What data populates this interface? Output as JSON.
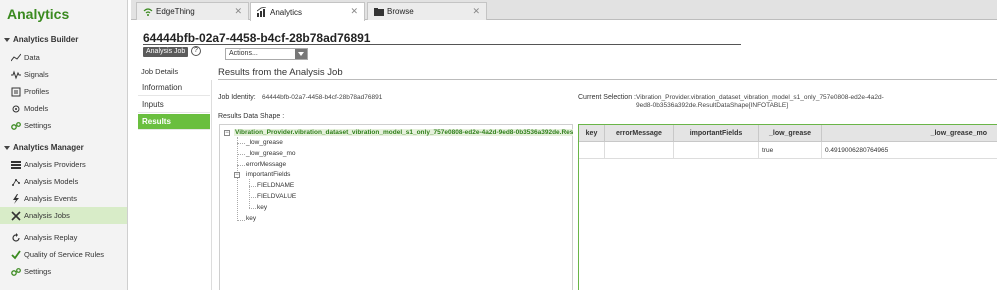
{
  "app": {
    "title": "Analytics"
  },
  "nav": {
    "builder_header": "Analytics Builder",
    "builder_items": [
      {
        "label": "Data",
        "icon": "data-chart-icon"
      },
      {
        "label": "Signals",
        "icon": "signals-icon"
      },
      {
        "label": "Profiles",
        "icon": "profiles-icon"
      },
      {
        "label": "Models",
        "icon": "models-icon"
      },
      {
        "label": "Settings",
        "icon": "settings-icon"
      }
    ],
    "manager_header": "Analytics Manager",
    "manager_items": [
      {
        "label": "Analysis Providers",
        "icon": "providers-icon"
      },
      {
        "label": "Analysis Models",
        "icon": "analysis-models-icon"
      },
      {
        "label": "Analysis Events",
        "icon": "events-icon"
      },
      {
        "label": "Analysis Jobs",
        "icon": "jobs-icon",
        "active": true
      },
      {
        "label": "Analysis Replay",
        "icon": "replay-icon"
      },
      {
        "label": "Quality of Service Rules",
        "icon": "checkmark-icon"
      },
      {
        "label": "Settings",
        "icon": "settings-icon"
      }
    ]
  },
  "tabs": [
    {
      "label": "EdgeThing",
      "icon": "edgething-icon"
    },
    {
      "label": "Analytics",
      "icon": "analytics-icon",
      "active": true
    },
    {
      "label": "Browse",
      "icon": "folder-icon"
    }
  ],
  "header": {
    "job_id_title": "64444bfb-02a7-4458-b4cf-28b78ad76891",
    "badge": "Analysis Job",
    "help": "?",
    "actions": "Actions..."
  },
  "subnav": {
    "title": "Job Details",
    "items": [
      "Information",
      "Inputs",
      "Results"
    ]
  },
  "results": {
    "title": "Results from the Analysis Job",
    "job_identity_label": "Job Identity:",
    "job_identity_value": "64444bfb-02a7-4458-b4cf-28b78ad76891",
    "current_selection_label": "Current Selection :",
    "current_selection_line1": "Vibration_Provider.vibration_dataset_vibration_model_s1_only_757e0808-ed2e-4a2d-",
    "current_selection_line2": "9ed8-0b3536a392de.ResultDataShape[INFOTABLE]",
    "data_shape_label": "Results Data Shape :",
    "tree": {
      "root": "Vibration_Provider.vibration_dataset_vibration_model_s1_only_757e0808-ed2e-4a2d-9ed8-0b3536a392de.Result",
      "children": [
        "_low_grease",
        "_low_grease_mo",
        "errorMessage",
        "importantFields",
        "key"
      ],
      "important_children": [
        "FIELDNAME",
        "FIELDVALUE",
        "key"
      ]
    },
    "grid": {
      "columns": [
        "key",
        "errorMessage",
        "importantFields",
        "_low_grease",
        "_low_grease_mo"
      ],
      "rows": [
        [
          "",
          "",
          "",
          "true",
          "0.4919006280764965"
        ]
      ]
    }
  },
  "colors": {
    "brand_green": "#3a8a1f",
    "active_green": "#6abf3f",
    "nav_active_bg": "#d8ecc8"
  }
}
